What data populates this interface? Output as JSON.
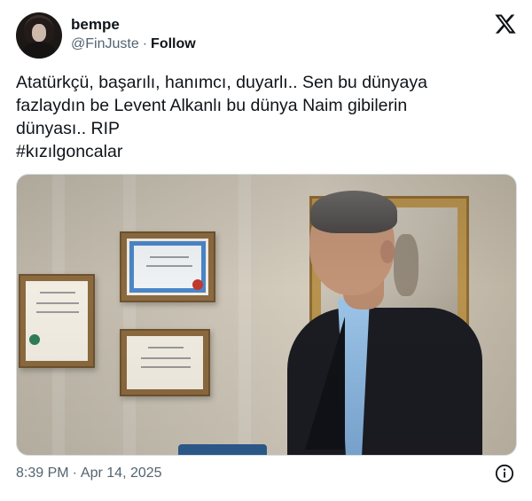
{
  "author": {
    "name": "bempe",
    "handle": "@FinJuste",
    "separator": "·",
    "follow_label": "Follow",
    "avatar_icon": "profile-avatar"
  },
  "brand": {
    "logo_icon": "x-logo-icon"
  },
  "tweet": {
    "lines": [
      "Atatürkçü, başarılı, hanımcı, duyarlı.. Sen bu dünyaya",
      "fazlaydın be Levent Alkanlı bu dünya Naim gibilerin",
      "dünyası.. RIP"
    ],
    "hashtag": "#kızılgoncalar"
  },
  "media": {
    "type": "video-thumbnail"
  },
  "footer": {
    "time": "8:39 PM",
    "separator": "·",
    "date": "Apr 14, 2025",
    "info_icon": "info-icon"
  },
  "colors": {
    "text": "#0f1419",
    "muted": "#536471",
    "background": "#ffffff"
  }
}
